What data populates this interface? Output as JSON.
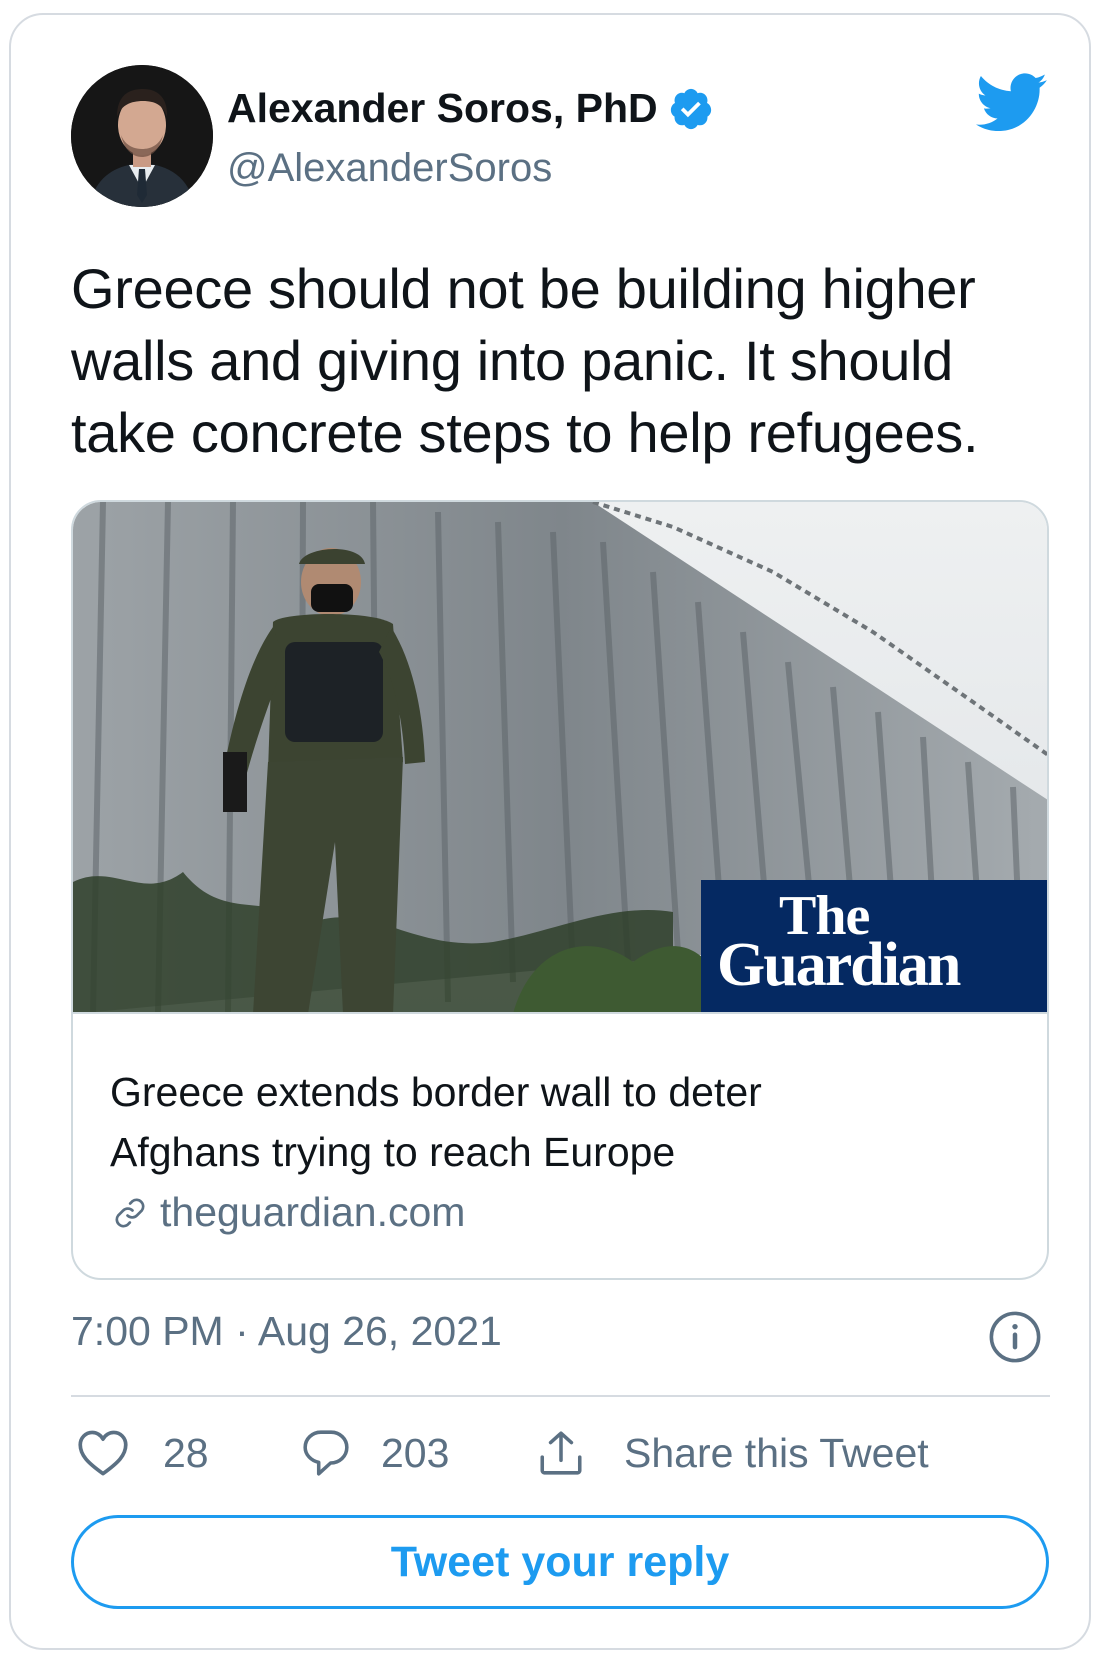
{
  "author": {
    "name": "Alexander Soros, PhD",
    "handle": "@AlexanderSoros",
    "verified": true
  },
  "tweet": {
    "text_lines": [
      "Greece should not be building higher",
      "walls and giving into panic. It should",
      "take concrete steps to help refugees."
    ]
  },
  "link_card": {
    "image_logo": [
      "The",
      "Guardian"
    ],
    "title_lines": [
      "Greece extends border wall to deter",
      "Afghans trying to reach Europe"
    ],
    "domain": "theguardian.com"
  },
  "timestamp": "7:00 PM · Aug 26, 2021",
  "actions": {
    "likes": "28",
    "replies": "203",
    "share_label": "Share this Tweet"
  },
  "reply_button_label": "Tweet your reply",
  "colors": {
    "accent": "#1d9bf0",
    "secondary_text": "#5b7083",
    "border": "#d6dbe1",
    "guardian_blue": "#052962"
  },
  "icons": [
    "twitter-bird-icon",
    "verified-badge-icon",
    "link-icon",
    "info-icon",
    "heart-icon",
    "reply-bubble-icon",
    "share-icon"
  ]
}
